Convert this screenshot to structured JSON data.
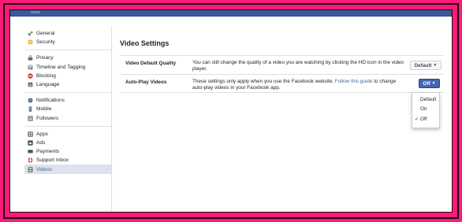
{
  "sidebar": {
    "groups": [
      {
        "items": [
          {
            "label": "General",
            "icon": "gear-icon"
          },
          {
            "label": "Security",
            "icon": "lock-icon"
          }
        ]
      },
      {
        "items": [
          {
            "label": "Privacy",
            "icon": "privacy-lock-icon"
          },
          {
            "label": "Timeline and Tagging",
            "icon": "timeline-icon"
          },
          {
            "label": "Blocking",
            "icon": "blocking-icon"
          },
          {
            "label": "Language",
            "icon": "globe-icon"
          }
        ]
      },
      {
        "items": [
          {
            "label": "Notifications",
            "icon": "globe-notification-icon"
          },
          {
            "label": "Mobile",
            "icon": "phone-icon"
          },
          {
            "label": "Followers",
            "icon": "rss-icon"
          }
        ]
      },
      {
        "items": [
          {
            "label": "Apps",
            "icon": "apps-icon"
          },
          {
            "label": "Ads",
            "icon": "ads-icon"
          },
          {
            "label": "Payments",
            "icon": "credit-card-icon"
          },
          {
            "label": "Support Inbox",
            "icon": "lifebuoy-icon"
          },
          {
            "label": "Videos",
            "icon": "film-icon",
            "active": true
          }
        ]
      }
    ]
  },
  "main": {
    "title": "Video Settings",
    "rows": [
      {
        "name": "Video Default Quality",
        "description": "You can still change the quality of a video you are watching by clicking the HD icon in the video player.",
        "control_label": "Default"
      },
      {
        "name": "Auto-Play Videos",
        "description_before": "These settings only apply when you use the Facebook website. ",
        "description_link": "Follow this guide",
        "description_after": " to change auto-play videos in your Facebook app.",
        "control_label": "Off"
      }
    ]
  },
  "dropdown": {
    "options": [
      "Default",
      "On",
      "Off"
    ],
    "selected": "Off",
    "check_glyph": "✓"
  },
  "colors": {
    "frame_border": "#ff1a7a",
    "topbar": "#3b5998",
    "link": "#4b67a1",
    "primary_button": "#4267b2",
    "active_sidebar_bg": "#dde2ec"
  }
}
